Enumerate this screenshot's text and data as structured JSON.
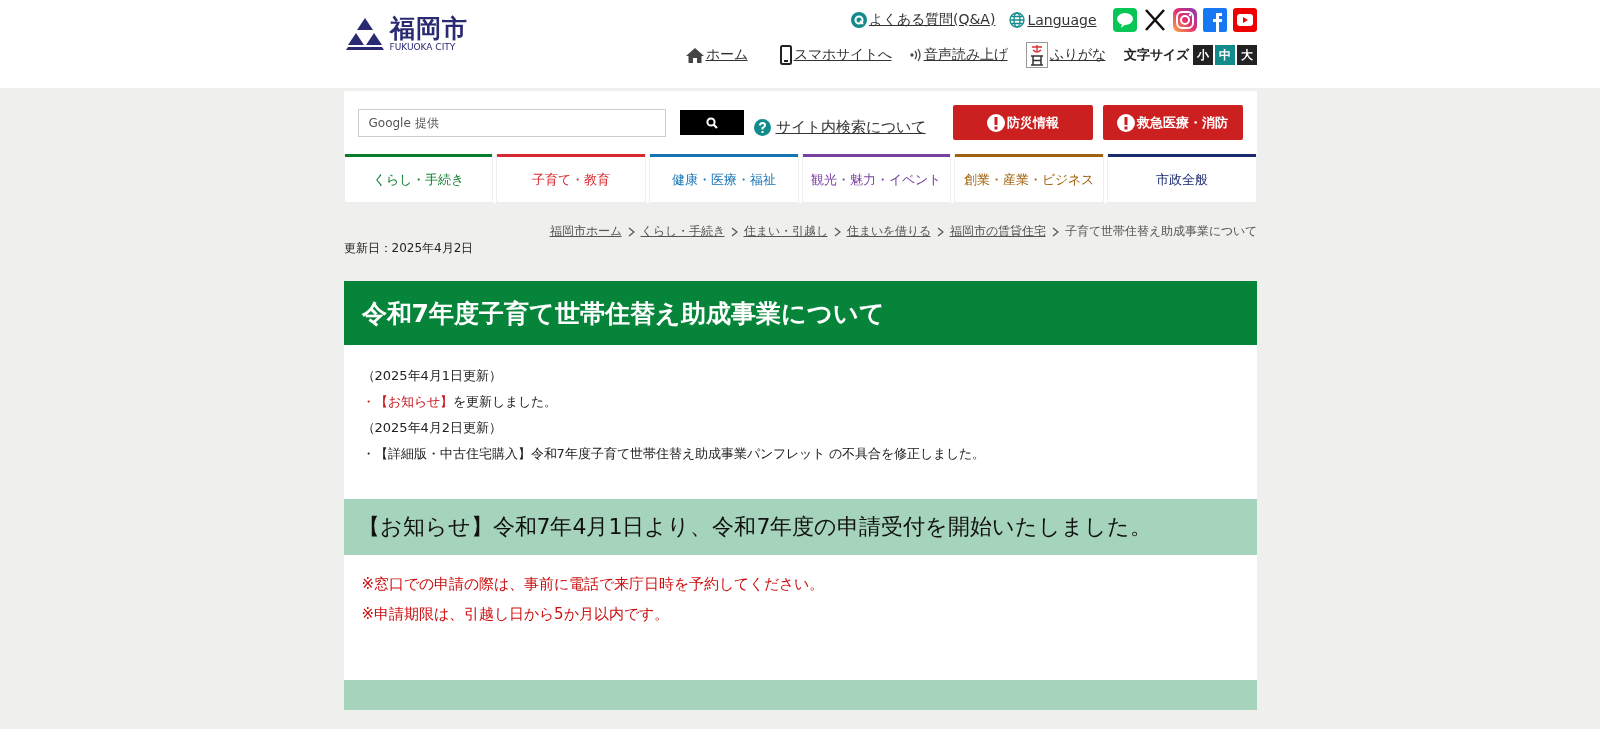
{
  "header": {
    "logo_title": "福岡市",
    "logo_subtitle": "FUKUOKA CITY",
    "top_links": [
      {
        "kind": "faq",
        "label": "よくある質問(Q&A)"
      },
      {
        "kind": "language",
        "label": "Language"
      }
    ],
    "tools": [
      {
        "kind": "home",
        "label": "ホーム"
      },
      {
        "kind": "mobile",
        "label": "スマホサイトへ"
      },
      {
        "kind": "voice",
        "label": "音声読み上げ"
      },
      {
        "kind": "furigana",
        "label": "ふりがな"
      }
    ],
    "font_size": {
      "label": "文字サイズ",
      "options": [
        {
          "label": "小",
          "selected": false
        },
        {
          "label": "中",
          "selected": true
        },
        {
          "label": "大",
          "selected": false
        }
      ]
    }
  },
  "search": {
    "placeholder": "Google 提供",
    "help_link": "サイト内検索について"
  },
  "emergency_buttons": [
    "防災情報",
    "救急医療・消防"
  ],
  "nav": [
    {
      "label": "くらし・手続き",
      "color": "#0a7d2c"
    },
    {
      "label": "子育て・教育",
      "color": "#d7282f"
    },
    {
      "label": "健康・医療・福祉",
      "color": "#1474b4"
    },
    {
      "label": "観光・魅力・イベント",
      "color": "#7a40a0"
    },
    {
      "label": "創業・産業・ビジネス",
      "color": "#a0620e"
    },
    {
      "label": "市政全般",
      "color": "#1a2a6c"
    }
  ],
  "breadcrumb": [
    {
      "kind": "link",
      "label": "福岡市ホーム"
    },
    {
      "kind": "link",
      "label": "くらし・手続き"
    },
    {
      "kind": "link",
      "label": "住まい・引越し"
    },
    {
      "kind": "link",
      "label": "住まいを借りる"
    },
    {
      "kind": "link",
      "label": "福岡市の賃貸住宅"
    },
    {
      "kind": "current",
      "label": "子育て世帯住替え助成事業について"
    }
  ],
  "updated": "更新日：2025年4月2日",
  "page_title": "令和7年度子育て世帯住替え助成事業について",
  "updates": [
    {
      "parts": [
        {
          "kind": "plain",
          "text": "（2025年4月1日更新）"
        }
      ]
    },
    {
      "parts": [
        {
          "kind": "link",
          "text": "・【お知らせ】"
        },
        {
          "kind": "plain",
          "text": "を更新しました。"
        }
      ]
    },
    {
      "parts": [
        {
          "kind": "plain",
          "text": "（2025年4月2日更新）"
        }
      ]
    },
    {
      "parts": [
        {
          "kind": "plain",
          "text": "・【詳細版・中古住宅購入】令和7年度子育て世帯住替え助成事業パンフレット の不具合を修正しました。"
        }
      ]
    }
  ],
  "notice": {
    "heading": "【お知らせ】令和7年4月1日より、令和7年度の申請受付を開始いたしました。",
    "lines": [
      "※窓口での申請の際は、事前に電話で来庁日時を予約してください。",
      "※申請期限は、引越し日から5か月以内です。"
    ]
  }
}
